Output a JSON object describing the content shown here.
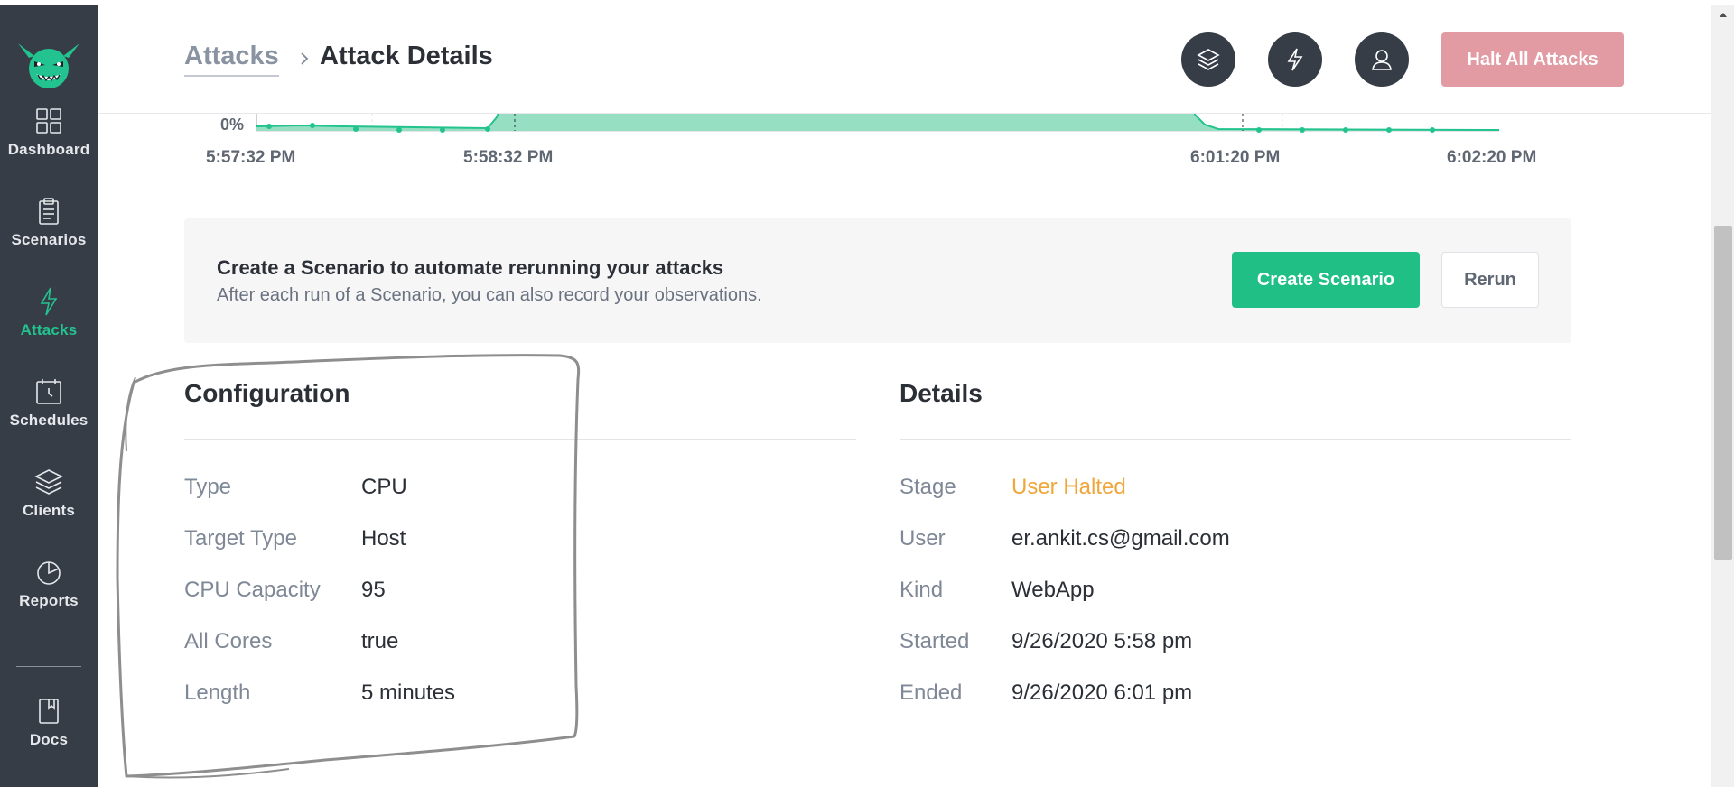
{
  "sidebar": {
    "logo_icon": "goblin-logo-icon",
    "items": [
      {
        "label": "Dashboard",
        "icon": "grid-icon",
        "active": false
      },
      {
        "label": "Scenarios",
        "icon": "clipboard-icon",
        "active": false
      },
      {
        "label": "Attacks",
        "icon": "lightning-icon",
        "active": true
      },
      {
        "label": "Schedules",
        "icon": "calendar-clock-icon",
        "active": false
      },
      {
        "label": "Clients",
        "icon": "layers-icon",
        "active": false
      },
      {
        "label": "Reports",
        "icon": "pie-chart-icon",
        "active": false
      },
      {
        "label": "Docs",
        "icon": "book-icon",
        "active": false
      }
    ]
  },
  "header": {
    "breadcrumb_root": "Attacks",
    "breadcrumb_current": "Attack Details",
    "icons": [
      "layers-icon",
      "lightning-icon",
      "user-icon"
    ],
    "halt_button": "Halt All Attacks"
  },
  "chart": {
    "y_label": "0%",
    "time_labels": [
      "5:57:32 PM",
      "5:58:32 PM",
      "6:01:20 PM",
      "6:02:20 PM"
    ],
    "series_color": "#22c38e"
  },
  "banner": {
    "title": "Create a Scenario to automate rerunning your attacks",
    "subtitle": "After each run of a Scenario, you can also record your observations.",
    "create_button": "Create Scenario",
    "rerun_button": "Rerun"
  },
  "configuration": {
    "title": "Configuration",
    "rows": [
      {
        "key": "Type",
        "value": "CPU"
      },
      {
        "key": "Target Type",
        "value": "Host"
      },
      {
        "key": "CPU Capacity",
        "value": "95"
      },
      {
        "key": "All Cores",
        "value": "true"
      },
      {
        "key": "Length",
        "value": "5 minutes"
      }
    ]
  },
  "details": {
    "title": "Details",
    "rows": [
      {
        "key": "Stage",
        "value": "User Halted"
      },
      {
        "key": "User",
        "value": "er.ankit.cs@gmail.com"
      },
      {
        "key": "Kind",
        "value": "WebApp"
      },
      {
        "key": "Started",
        "value": "9/26/2020 5:58 pm"
      },
      {
        "key": "Ended",
        "value": "9/26/2020 6:01 pm"
      }
    ],
    "stage_color": "#f0a63a"
  },
  "colors": {
    "sidebar_bg": "#363d47",
    "accent_green": "#1fbf86",
    "halt_pink": "#e29aa3"
  }
}
